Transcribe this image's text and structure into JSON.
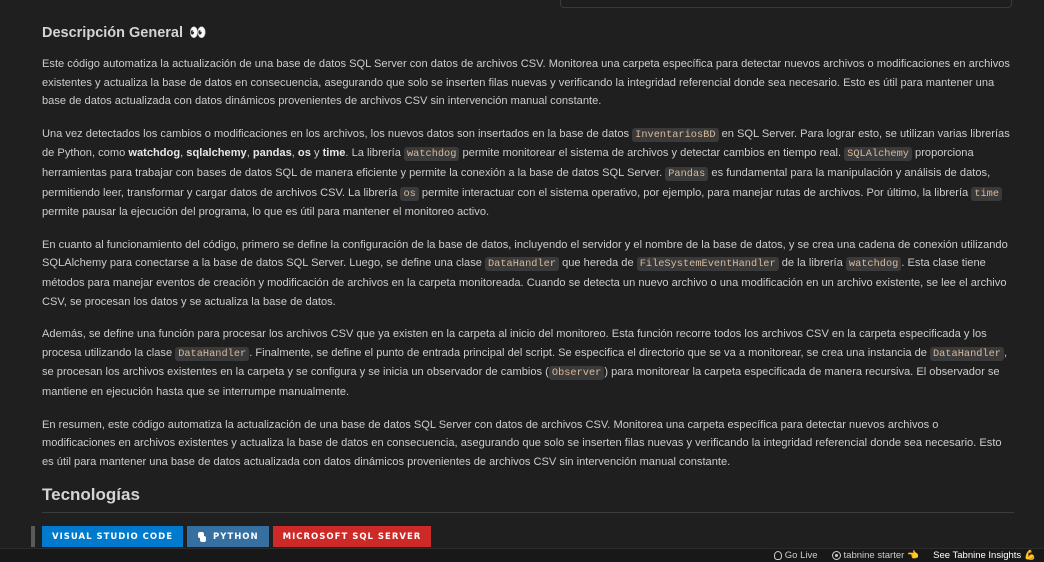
{
  "overview": {
    "title": "Descripción General",
    "title_emoji": "👀",
    "p1": "Este código automatiza la actualización de una base de datos SQL Server con datos de archivos CSV. Monitorea una carpeta específica para detectar nuevos archivos o modificaciones en archivos existentes y actualiza la base de datos en consecuencia, asegurando que solo se inserten filas nuevas y verificando la integridad referencial donde sea necesario. Esto es útil para mantener una base de datos actualizada con datos dinámicos provenientes de archivos CSV sin intervención manual constante.",
    "p2": {
      "t1": "Una vez detectados los cambios o modificaciones en los archivos, los nuevos datos son insertados en la base de datos ",
      "c1": "InventariosBD",
      "t2": " en SQL Server. Para lograr esto, se utilizan varias librerías de Python, como ",
      "b1": "watchdog",
      "t3": ", ",
      "b2": "sqlalchemy",
      "t4": ", ",
      "b3": "pandas",
      "t5": ", ",
      "b4": "os",
      "t6": " y ",
      "b5": "time",
      "t7": ". La librería ",
      "c2": "watchdog",
      "t8": " permite monitorear el sistema de archivos y detectar cambios en tiempo real. ",
      "c3": "SQLAlchemy",
      "t9": " proporciona herramientas para trabajar con bases de datos SQL de manera eficiente y permite la conexión a la base de datos SQL Server. ",
      "c4": "Pandas",
      "t10": " es fundamental para la manipulación y análisis de datos, permitiendo leer, transformar y cargar datos de archivos CSV. La librería ",
      "c5": "os",
      "t11": " permite interactuar con el sistema operativo, por ejemplo, para manejar rutas de archivos. Por último, la librería ",
      "c6": "time",
      "t12": " permite pausar la ejecución del programa, lo que es útil para mantener el monitoreo activo."
    },
    "p3": {
      "t1": "En cuanto al funcionamiento del código, primero se define la configuración de la base de datos, incluyendo el servidor y el nombre de la base de datos, y se crea una cadena de conexión utilizando SQLAlchemy para conectarse a la base de datos SQL Server. Luego, se define una clase ",
      "c1": "DataHandler",
      "t2": " que hereda de ",
      "c2": "FileSystemEventHandler",
      "t3": " de la librería ",
      "c3": "watchdog",
      "t4": ". Esta clase tiene métodos para manejar eventos de creación y modificación de archivos en la carpeta monitoreada. Cuando se detecta un nuevo archivo o una modificación en un archivo existente, se lee el archivo CSV, se procesan los datos y se actualiza la base de datos."
    },
    "p4": {
      "t1": "Además, se define una función para procesar los archivos CSV que ya existen en la carpeta al inicio del monitoreo. Esta función recorre todos los archivos CSV en la carpeta especificada y los procesa utilizando la clase ",
      "c1": "DataHandler",
      "t2": ". Finalmente, se define el punto de entrada principal del script. Se especifica el directorio que se va a monitorear, se crea una instancia de ",
      "c2": "DataHandler",
      "t3": ", se procesan los archivos existentes en la carpeta y se configura y se inicia un observador de cambios (",
      "c3": "Observer",
      "t4": ") para monitorear la carpeta especificada de manera recursiva. El observador se mantiene en ejecución hasta que se interrumpe manualmente."
    },
    "p5": "En resumen, este código automatiza la actualización de una base de datos SQL Server con datos de archivos CSV. Monitorea una carpeta específica para detectar nuevos archivos o modificaciones en archivos existentes y actualiza la base de datos en consecuencia, asegurando que solo se inserten filas nuevas y verificando la integridad referencial donde sea necesario. Esto es útil para mantener una base de datos actualizada con datos dinámicos provenientes de archivos CSV sin intervención manual constante."
  },
  "tech": {
    "title": "Tecnologías",
    "badges": [
      "VISUAL STUDIO CODE",
      "PYTHON",
      "MICROSOFT SQL SERVER"
    ],
    "badge_colors": [
      "#007acc",
      "#3670a0",
      "#cc2927"
    ]
  },
  "statusbar": {
    "go_live": "Go Live",
    "tabnine": "tabnine starter",
    "tabnine_emoji": "👈",
    "insights": "See Tabnine Insights",
    "insights_emoji": "💪"
  }
}
